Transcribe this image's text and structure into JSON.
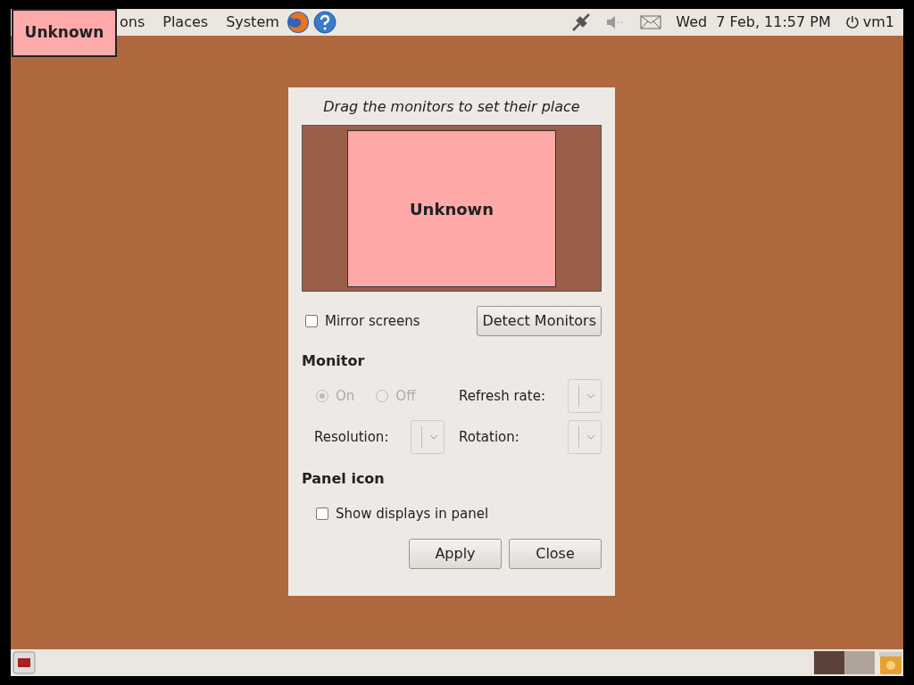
{
  "top_panel": {
    "menus": [
      "ons",
      "Places",
      "System"
    ],
    "clock": "Wed  7 Feb, 11:57 PM",
    "user": "vm1"
  },
  "monitor_label": "Unknown",
  "dialog": {
    "hint": "Drag the monitors to set their place",
    "monitor_name": "Unknown",
    "mirror": {
      "label": "Mirror screens",
      "checked": false
    },
    "detect_button": "Detect Monitors",
    "monitor_heading": "Monitor",
    "power": [
      {
        "label": "On",
        "selected": true,
        "disabled": true
      },
      {
        "label": "Off",
        "selected": false,
        "disabled": true
      }
    ],
    "refresh_label": "Refresh rate:",
    "resolution_label": "Resolution:",
    "rotation_label": "Rotation:",
    "panel_heading": "Panel icon",
    "show_in_panel": {
      "label": "Show displays in panel",
      "checked": false
    },
    "buttons": [
      "Apply",
      "Close"
    ]
  },
  "bottom_panel": {
    "workspaces": [
      {
        "selected": true
      },
      {
        "selected": false
      }
    ]
  }
}
